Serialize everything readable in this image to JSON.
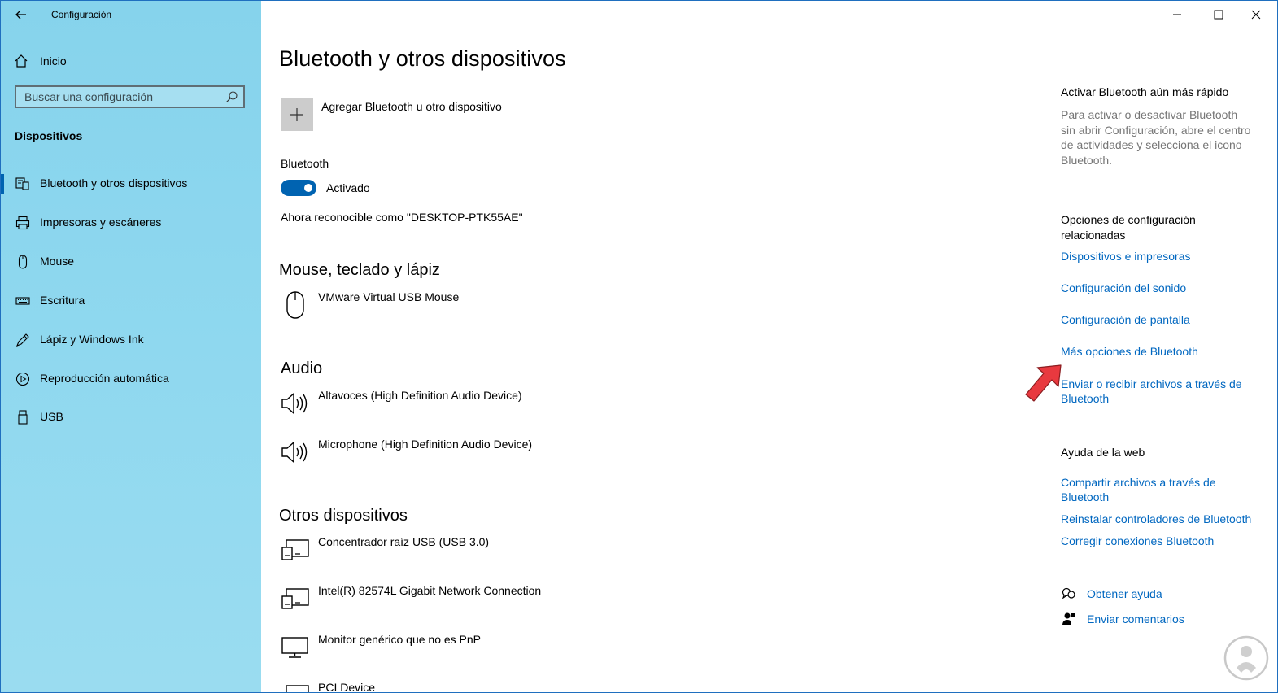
{
  "window": {
    "title": "Configuración",
    "controls": {
      "minimize": "minimize-icon",
      "maximize": "maximize-icon",
      "close": "close-icon"
    }
  },
  "sidebar": {
    "home_label": "Inicio",
    "search_placeholder": "Buscar una configuración",
    "section_title": "Dispositivos",
    "items": [
      {
        "label": "Bluetooth y otros dispositivos",
        "icon": "bluetooth-devices-icon",
        "active": true
      },
      {
        "label": "Impresoras y escáneres",
        "icon": "printer-icon",
        "active": false
      },
      {
        "label": "Mouse",
        "icon": "mouse-icon",
        "active": false
      },
      {
        "label": "Escritura",
        "icon": "keyboard-icon",
        "active": false
      },
      {
        "label": "Lápiz y Windows Ink",
        "icon": "pen-icon",
        "active": false
      },
      {
        "label": "Reproducción automática",
        "icon": "autoplay-icon",
        "active": false
      },
      {
        "label": "USB",
        "icon": "usb-icon",
        "active": false
      }
    ]
  },
  "main": {
    "title": "Bluetooth y otros dispositivos",
    "add_device_label": "Agregar Bluetooth u otro dispositivo",
    "bluetooth": {
      "label": "Bluetooth",
      "state_text": "Activado",
      "on": true,
      "discoverable_text": "Ahora reconocible como \"DESKTOP-PTK55AE\""
    },
    "groups": {
      "mouse": {
        "heading": "Mouse, teclado y lápiz",
        "devices": [
          {
            "name": "VMware Virtual USB Mouse",
            "icon": "mouse-icon"
          }
        ]
      },
      "audio": {
        "heading": "Audio",
        "devices": [
          {
            "name": "Altavoces (High Definition Audio Device)",
            "icon": "speaker-icon"
          },
          {
            "name": "Microphone (High Definition Audio Device)",
            "icon": "speaker-icon"
          }
        ]
      },
      "other": {
        "heading": "Otros dispositivos",
        "devices": [
          {
            "name": "Concentrador raíz USB (USB 3.0)",
            "icon": "generic-device-icon"
          },
          {
            "name": "Intel(R) 82574L Gigabit Network Connection",
            "icon": "generic-device-icon"
          },
          {
            "name": "Monitor genérico que no es PnP",
            "icon": "monitor-icon"
          },
          {
            "name": "PCI Device",
            "icon": "generic-device-icon"
          }
        ]
      }
    }
  },
  "right": {
    "quick_heading": "Activar Bluetooth aún más rápido",
    "quick_text": "Para activar o desactivar Bluetooth sin abrir Configuración, abre el centro de actividades y selecciona el icono Bluetooth.",
    "related_heading": "Opciones de configuración relacionadas",
    "related_links": [
      "Dispositivos e impresoras",
      "Configuración del sonido",
      "Configuración de pantalla",
      "Más opciones de Bluetooth",
      "Enviar o recibir archivos a través de Bluetooth"
    ],
    "web_heading": "Ayuda de la web",
    "web_links": [
      "Compartir archivos a través de Bluetooth",
      "Reinstalar controladores de Bluetooth",
      "Corregir conexiones Bluetooth"
    ],
    "get_help": "Obtener ayuda",
    "feedback": "Enviar comentarios"
  },
  "colors": {
    "sidebar_bg": "#8fd8ef",
    "accent": "#0063b1",
    "link": "#0067c0",
    "annotation_arrow": "#e8393f"
  }
}
